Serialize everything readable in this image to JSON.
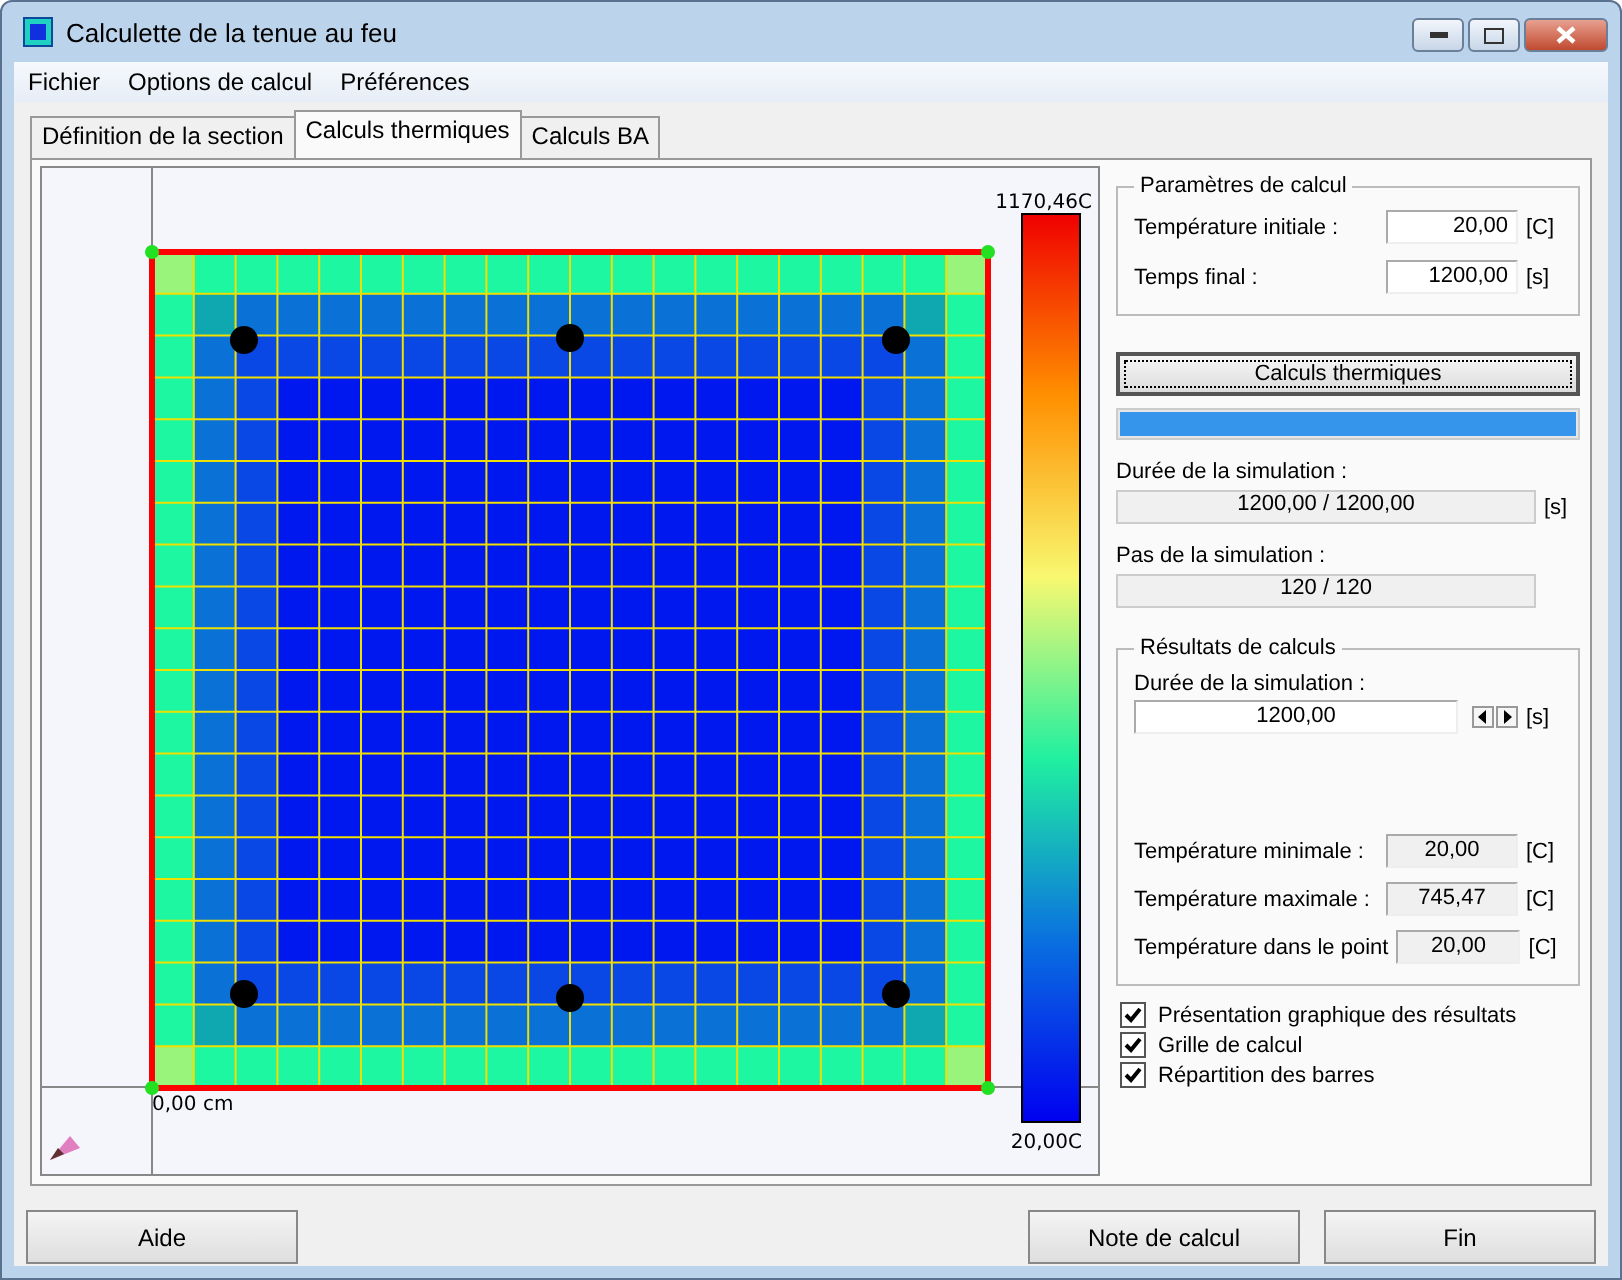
{
  "window": {
    "title": "Calculette de la tenue au feu"
  },
  "menu": [
    "Fichier",
    "Options de calcul",
    "Préférences"
  ],
  "tabs": [
    {
      "label": "Définition de la section",
      "selected": false
    },
    {
      "label": "Calculs thermiques",
      "selected": true
    },
    {
      "label": "Calculs BA",
      "selected": false
    }
  ],
  "canvas": {
    "origin_label": "0,00 cm",
    "scale_max": "1170,46C",
    "scale_min": "20,00C"
  },
  "parameters": {
    "title": "Paramètres de calcul",
    "fields": [
      {
        "label": "Température initiale :",
        "value": "20,00",
        "unit": "[C]"
      },
      {
        "label": "Temps final :",
        "value": "1200,00",
        "unit": "[s]"
      }
    ]
  },
  "run_button": "Calculs thermiques",
  "progress": {
    "level": 1
  },
  "simulation_duration": {
    "label": "Durée de la simulation :",
    "value": "1200,00 / 1200,00",
    "unit": "[s]"
  },
  "simulation_step": {
    "label": "Pas de la simulation :",
    "value": "120 / 120"
  },
  "results": {
    "title": "Résultats de calculs",
    "duration_label": "Durée de la simulation :",
    "duration_value": "1200,00",
    "duration_unit": "[s]",
    "rows": [
      {
        "label": "Température minimale :",
        "value": "20,00",
        "unit": "[C]"
      },
      {
        "label": "Température maximale :",
        "value": "745,47",
        "unit": "[C]"
      },
      {
        "label": "Température dans le point",
        "value": "20,00",
        "unit": "[C]"
      }
    ]
  },
  "options": [
    {
      "label": "Présentation graphique des résultats",
      "checked": true
    },
    {
      "label": "Grille de calcul",
      "checked": true
    },
    {
      "label": "Répartition des barres",
      "checked": true
    }
  ],
  "buttons": {
    "help": "Aide",
    "note": "Note de calcul",
    "close": "Fin"
  }
}
